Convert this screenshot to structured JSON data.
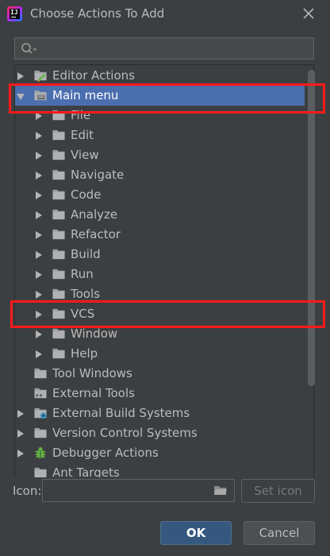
{
  "window": {
    "title": "Choose Actions To Add"
  },
  "search": {
    "placeholder": "",
    "value": ""
  },
  "tree": {
    "items": [
      {
        "label": "Editor Actions",
        "level": 0,
        "expander": "collapsed",
        "icon": "editor-actions-icon"
      },
      {
        "label": "Main menu",
        "level": 0,
        "expander": "expanded",
        "icon": "menu-icon",
        "selected": true
      },
      {
        "label": "File",
        "level": 1,
        "expander": "collapsed",
        "icon": "folder-icon"
      },
      {
        "label": "Edit",
        "level": 1,
        "expander": "collapsed",
        "icon": "folder-icon"
      },
      {
        "label": "View",
        "level": 1,
        "expander": "collapsed",
        "icon": "folder-icon"
      },
      {
        "label": "Navigate",
        "level": 1,
        "expander": "collapsed",
        "icon": "folder-icon"
      },
      {
        "label": "Code",
        "level": 1,
        "expander": "collapsed",
        "icon": "folder-icon"
      },
      {
        "label": "Analyze",
        "level": 1,
        "expander": "collapsed",
        "icon": "folder-icon"
      },
      {
        "label": "Refactor",
        "level": 1,
        "expander": "collapsed",
        "icon": "folder-icon"
      },
      {
        "label": "Build",
        "level": 1,
        "expander": "collapsed",
        "icon": "folder-icon"
      },
      {
        "label": "Run",
        "level": 1,
        "expander": "collapsed",
        "icon": "folder-icon"
      },
      {
        "label": "Tools",
        "level": 1,
        "expander": "collapsed",
        "icon": "folder-icon"
      },
      {
        "label": "VCS",
        "level": 1,
        "expander": "collapsed",
        "icon": "folder-icon"
      },
      {
        "label": "Window",
        "level": 1,
        "expander": "collapsed",
        "icon": "folder-icon"
      },
      {
        "label": "Help",
        "level": 1,
        "expander": "collapsed",
        "icon": "folder-icon"
      },
      {
        "label": "Tool Windows",
        "level": 0,
        "expander": "none",
        "icon": "folder-icon"
      },
      {
        "label": "External Tools",
        "level": 0,
        "expander": "none",
        "icon": "external-tools-icon"
      },
      {
        "label": "External Build Systems",
        "level": 0,
        "expander": "collapsed",
        "icon": "build-systems-icon"
      },
      {
        "label": "Version Control Systems",
        "level": 0,
        "expander": "collapsed",
        "icon": "folder-icon"
      },
      {
        "label": "Debugger Actions",
        "level": 0,
        "expander": "collapsed",
        "icon": "bug-icon"
      },
      {
        "label": "Ant Targets",
        "level": 0,
        "expander": "none",
        "icon": "folder-icon"
      }
    ]
  },
  "icon_field": {
    "label": "Icon:",
    "value": ""
  },
  "buttons": {
    "set_icon": "Set icon",
    "ok": "OK",
    "cancel": "Cancel"
  },
  "colors": {
    "background": "#3c3f41",
    "selection": "#4b6eaf",
    "highlight": "#ff1a1a",
    "ok_button": "#365880"
  }
}
